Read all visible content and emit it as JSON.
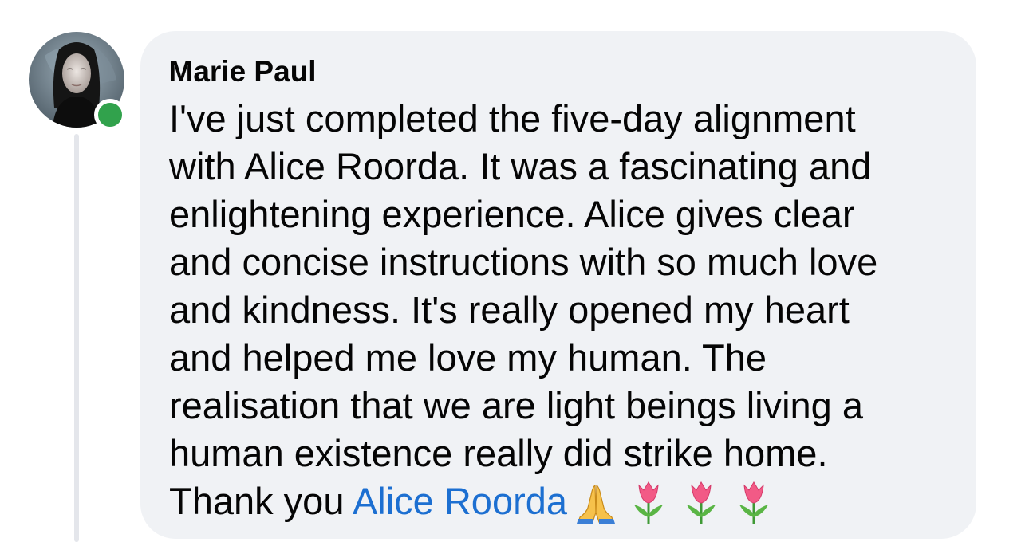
{
  "comment": {
    "author": "Marie Paul",
    "online": true,
    "body_lines": [
      "I've just completed the five-day alignment",
      "with Alice Roorda. It was a fascinating and",
      "enlightening experience. Alice gives clear",
      "and concise instructions with so much love",
      "and kindness. It's really opened my heart",
      "and helped me love my human. The",
      "realisation that we are light beings living a",
      "human existence really did strike home."
    ],
    "closing_text": "Thank you ",
    "mention": "Alice Roorda",
    "emojis": [
      "folded-hands",
      "tulip",
      "tulip",
      "tulip"
    ]
  },
  "colors": {
    "bubble": "#f0f2f5",
    "text": "#050505",
    "mention": "#1c6fd1",
    "online": "#31a24c",
    "thread_line": "#e4e6eb"
  }
}
